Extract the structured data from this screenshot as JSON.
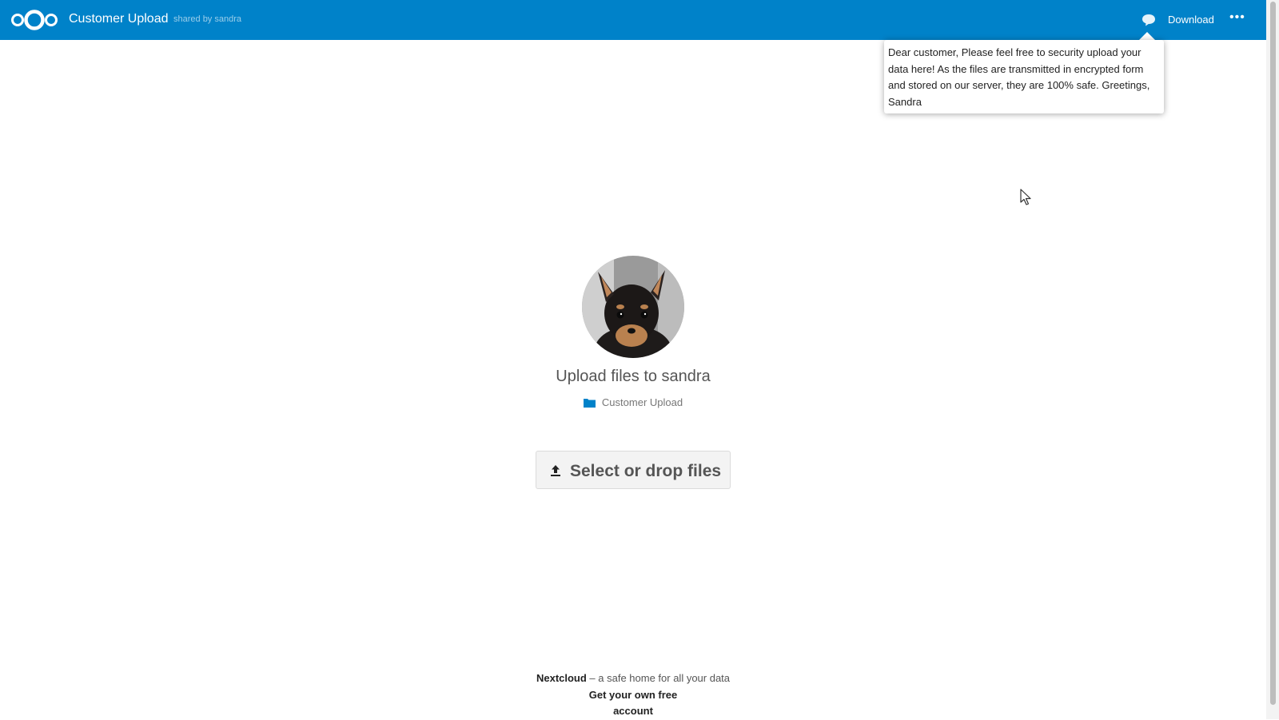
{
  "header": {
    "title": "Customer Upload",
    "shared_by": "shared by sandra",
    "download_label": "Download",
    "note_icon": "comment-icon",
    "more_icon": "more-horizontal-icon",
    "more_glyph": "•••"
  },
  "note": {
    "text": "Dear customer, Please feel free to security upload your data here! As the files are transmitted in encrypted form and stored on our server, they are 100% safe. Greetings, Sandra"
  },
  "main": {
    "upload_title": "Upload files to sandra",
    "folder_name": "Customer Upload",
    "upload_button": "Select or drop files"
  },
  "footer": {
    "brand": "Nextcloud",
    "tagline": " – a safe home for all your data",
    "signup_link": "Get your own free account"
  },
  "colors": {
    "brand": "#0082c9"
  }
}
